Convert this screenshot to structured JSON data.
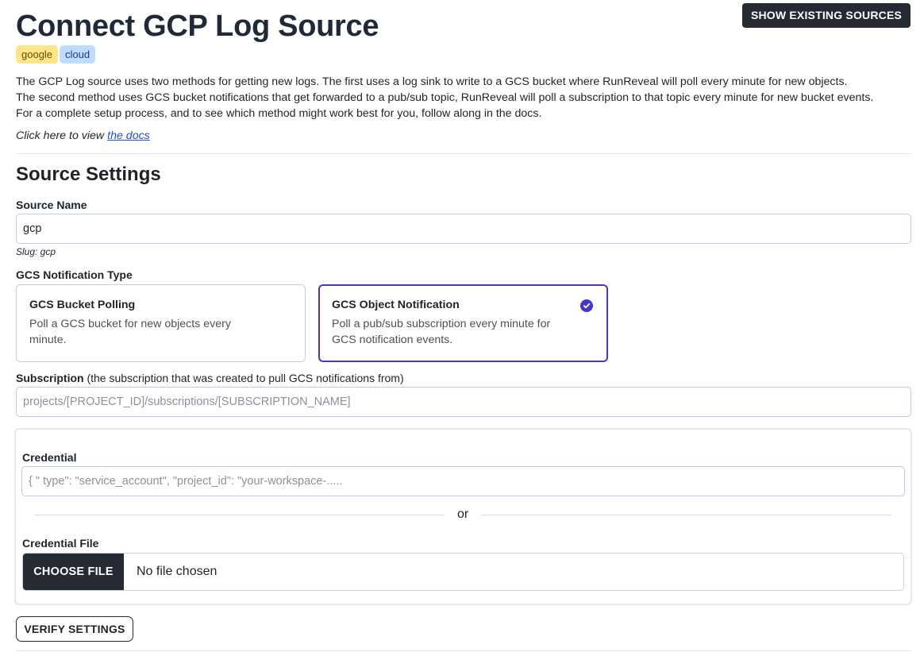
{
  "header": {
    "title": "Connect GCP Log Source",
    "show_sources_label": "SHOW EXISTING SOURCES",
    "tags": [
      "google",
      "cloud"
    ]
  },
  "description": {
    "lines": [
      "The GCP Log source uses two methods for getting new logs. The first uses a log sink to write to a GCS bucket where RunReveal will poll every minute for new objects.",
      "The second method uses GCS bucket notifications that get forwarded to a pub/sub topic, RunReveal will poll a subscription to that topic every minute for new bucket events.",
      "For a complete setup process, and to see which method might work best for you, follow along in the docs."
    ],
    "docs_prefix": "Click here to view",
    "docs_link": "the docs"
  },
  "settings": {
    "section_title": "Source Settings",
    "source_name": {
      "label": "Source Name",
      "value": "gcp",
      "slug_text": "Slug: gcp"
    },
    "notification_type": {
      "label": "GCS Notification Type",
      "options": [
        {
          "title": "GCS Bucket Polling",
          "description": "Poll a GCS bucket for new objects every minute.",
          "selected": false
        },
        {
          "title": "GCS Object Notification",
          "description": "Poll a pub/sub subscription every minute for GCS notification events.",
          "selected": true
        }
      ]
    },
    "subscription": {
      "label": "Subscription",
      "hint": "(the subscription that was created to pull GCS notifications from)",
      "placeholder": "projects/[PROJECT_ID]/subscriptions/[SUBSCRIPTION_NAME]",
      "value": ""
    },
    "credential": {
      "label": "Credential",
      "placeholder": "{ \" type\": \"service_account\", \"project_id\": \"your-workspace-.....",
      "or_text": "or",
      "file_label": "Credential File",
      "choose_file_label": "CHOOSE FILE",
      "no_file_text": "No file chosen"
    },
    "verify_label": "VERIFY SETTINGS"
  },
  "colors": {
    "primary_dark": "#252a33",
    "accent": "#4338ca",
    "tag_google_bg": "#fde68a",
    "tag_cloud_bg": "#bfdbfe",
    "link": "#1d4ed8"
  }
}
